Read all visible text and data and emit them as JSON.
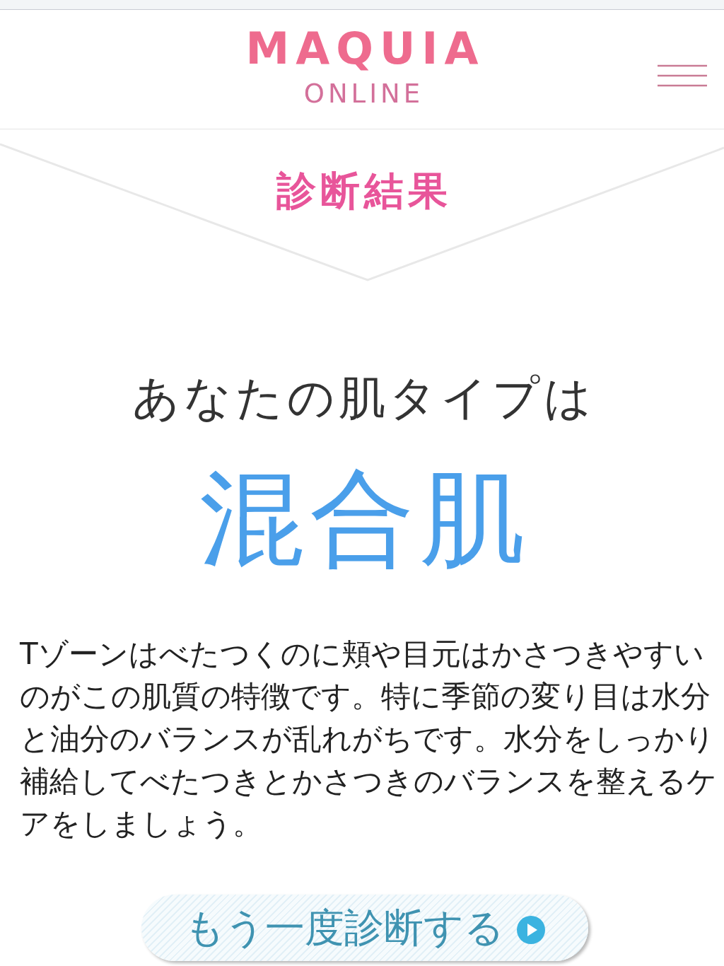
{
  "header": {
    "logo": {
      "title": "MAQUIA",
      "subtitle": "ONLINE"
    }
  },
  "banner": {
    "title": "診断結果"
  },
  "result": {
    "lead": "あなたの肌タイプは",
    "skin_type": "混合肌",
    "description": "Tゾーンはべたつくのに頬や目元はかさつきやすいのがこの肌質の特徴です。特に季節の変り目は水分と油分のバランスが乱れがちです。水分をしっかり補給してべたつきとかさつきのバランスを整えるケアをしましょう。"
  },
  "retry_button": {
    "label": "もう一度診断する"
  }
}
